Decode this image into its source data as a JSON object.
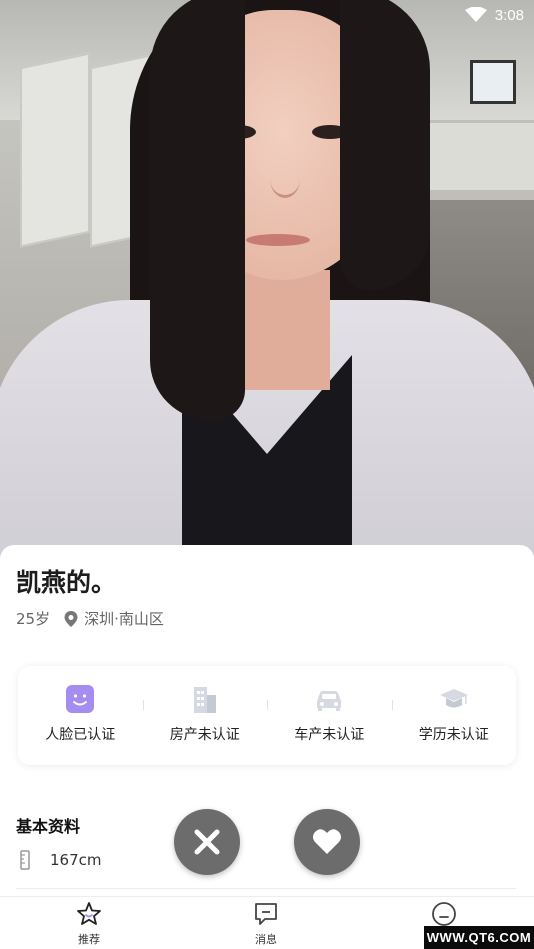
{
  "status_bar": {
    "time": "3:08",
    "wifi_icon": "wifi-icon"
  },
  "profile": {
    "name": "凯燕的。",
    "age": "25岁",
    "location": "深圳·南山区",
    "location_icon": "location-pin-icon"
  },
  "verifications": [
    {
      "label": "人脸已认证",
      "icon": "face-verified-icon",
      "verified": true,
      "color": "#a58cf0"
    },
    {
      "label": "房产未认证",
      "icon": "building-icon",
      "verified": false,
      "color": "#d6d9e2"
    },
    {
      "label": "车产未认证",
      "icon": "car-icon",
      "verified": false,
      "color": "#d6d9e2"
    },
    {
      "label": "学历未认证",
      "icon": "graduation-cap-icon",
      "verified": false,
      "color": "#d6d9e2"
    }
  ],
  "basic_info": {
    "title": "基本资料",
    "height": "167cm",
    "height_icon": "ruler-icon"
  },
  "actions": {
    "dislike_icon": "close-icon",
    "like_icon": "heart-icon",
    "button_color": "#6c6c6c"
  },
  "tabs": [
    {
      "label": "推荐",
      "icon": "star-icon",
      "active": true
    },
    {
      "label": "消息",
      "icon": "message-icon",
      "active": false
    },
    {
      "label": "",
      "icon": "smile-face-icon",
      "active": false
    }
  ],
  "watermark": "WWW.QT6.COM",
  "colors": {
    "accent": "#a58cf0",
    "highlight": "#c9b6f5"
  }
}
